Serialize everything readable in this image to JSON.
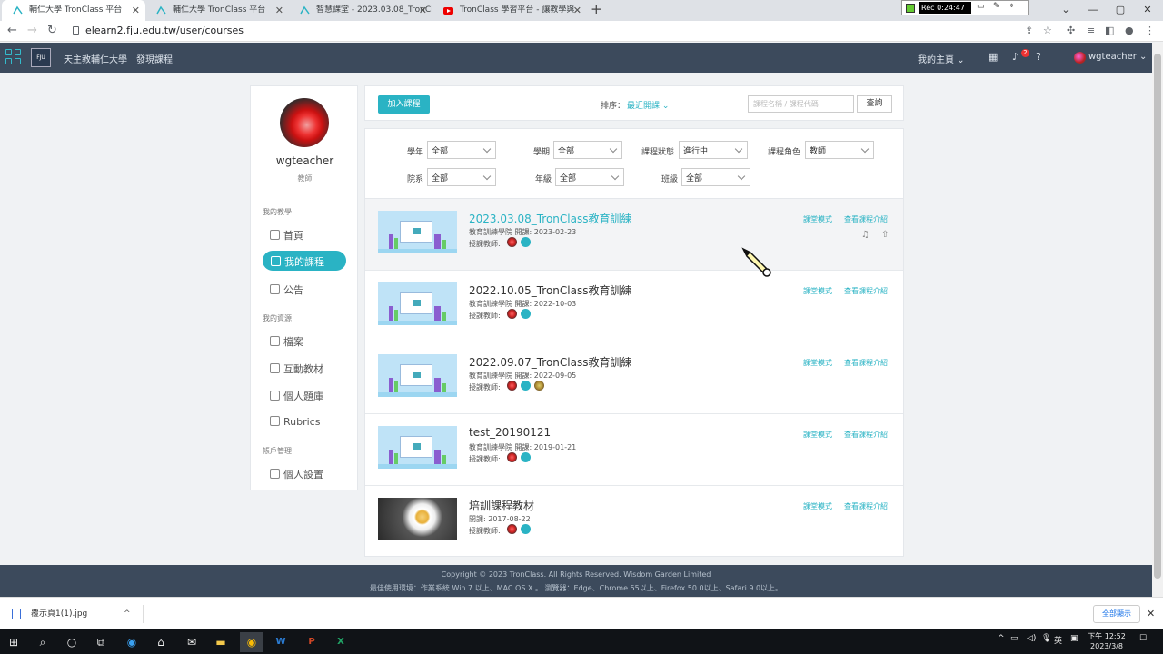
{
  "browser": {
    "tabs": [
      {
        "title": "輔仁大學 TronClass 平台"
      },
      {
        "title": "輔仁大學 TronClass 平台"
      },
      {
        "title": "智慧課堂 - 2023.03.08_TronCla"
      },
      {
        "title": "TronClass 學習平台 - 讓教學與..."
      }
    ],
    "url": "elearn2.fju.edu.tw/user/courses",
    "recorder_time": "Rec 0:24:47"
  },
  "app": {
    "school_link": "天主教輔仁大學",
    "discover_link": "發現課程",
    "my_home": "我的主頁",
    "notif_count": "2",
    "username": "wgteacher",
    "colors": {
      "accent": "#2ab3c4",
      "header": "#3c4a5c"
    }
  },
  "sidebar": {
    "name": "wgteacher",
    "role": "教師",
    "sections": [
      {
        "title": "我的教學"
      },
      {
        "title": "我的資源"
      },
      {
        "title": "帳戶管理"
      }
    ],
    "items": [
      {
        "label": "首頁",
        "icon": "home-icon"
      },
      {
        "label": "我的課程",
        "icon": "book-icon"
      },
      {
        "label": "公告",
        "icon": "megaphone-icon"
      },
      {
        "label": "檔案",
        "icon": "file-icon"
      },
      {
        "label": "互動教材",
        "icon": "media-icon"
      },
      {
        "label": "個人題庫",
        "icon": "question-bank-icon"
      },
      {
        "label": "Rubrics",
        "icon": "image-icon"
      },
      {
        "label": "個人設置",
        "icon": "settings-icon"
      }
    ]
  },
  "toolbar": {
    "add_course": "加入課程",
    "sort_label": "排序：",
    "sort_value": "最近開課",
    "search_placeholder": "課程名稱 / 課程代碼",
    "search_button": "查詢"
  },
  "filters": [
    {
      "label": "學年",
      "value": "全部"
    },
    {
      "label": "學期",
      "value": "全部"
    },
    {
      "label": "課程狀態",
      "value": "進行中"
    },
    {
      "label": "課程角色",
      "value": "教師"
    },
    {
      "label": "院系",
      "value": "全部"
    },
    {
      "label": "年級",
      "value": "全部"
    },
    {
      "label": "班級",
      "value": "全部"
    }
  ],
  "course_labels": {
    "teachers": "授課教師:",
    "classroom_mode": "課堂模式",
    "view_intro": "查看課程介紹"
  },
  "courses": [
    {
      "title": "2023.03.08_TronClass教育訓練",
      "meta": "教育訓練學院   開課: 2023-02-23"
    },
    {
      "title": "2022.10.05_TronClass教育訓練",
      "meta": "教育訓練學院   開課: 2022-10-03"
    },
    {
      "title": "2022.09.07_TronClass教育訓練",
      "meta": "教育訓練學院   開課: 2022-09-05"
    },
    {
      "title": "test_20190121",
      "meta": "教育訓練學院   開課: 2019-01-21"
    },
    {
      "title": "培訓課程教材",
      "meta": "開課: 2017-08-22"
    }
  ],
  "footer": {
    "copyright": "Copyright © 2023 TronClass. All Rights Reserved. Wisdom Garden Limited",
    "env": "最佳使用環境：作業系統 Win 7 以上、MAC OS X 。 瀏覽器：Edge、Chrome 55以上、Firefox 50.0以上、Safari 9.0以上。"
  },
  "download": {
    "filename": "覆示頁1(1).jpg",
    "show_all": "全部顯示"
  },
  "taskbar": {
    "ime": "英",
    "time": "下午 12:52",
    "date": "2023/3/8"
  }
}
